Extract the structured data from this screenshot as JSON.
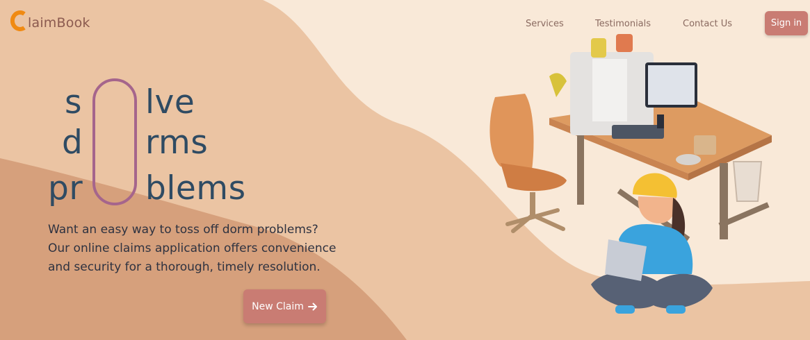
{
  "brand": {
    "name": "laimBook",
    "logo_icon": "c-letter-logo",
    "accent": "#f08a12"
  },
  "nav": {
    "services": "Services",
    "testimonials": "Testimonials",
    "contact": "Contact Us",
    "signin": "Sign in"
  },
  "hero": {
    "line1_left": "s",
    "line1_right": "lve",
    "line2_left": "d",
    "line2_right": "rms",
    "line3_left": "pr",
    "line3_right": "blems",
    "description": "Want an easy way to toss off dorm problems? Our online claims application offers convenience and security for a thorough, timely resolution.",
    "cta_label": "New Claim",
    "cta_icon": "arrow-right-icon"
  },
  "colors": {
    "primary_button": "#c97c73",
    "heading": "#2f4b63",
    "pill": "#a5658c"
  }
}
